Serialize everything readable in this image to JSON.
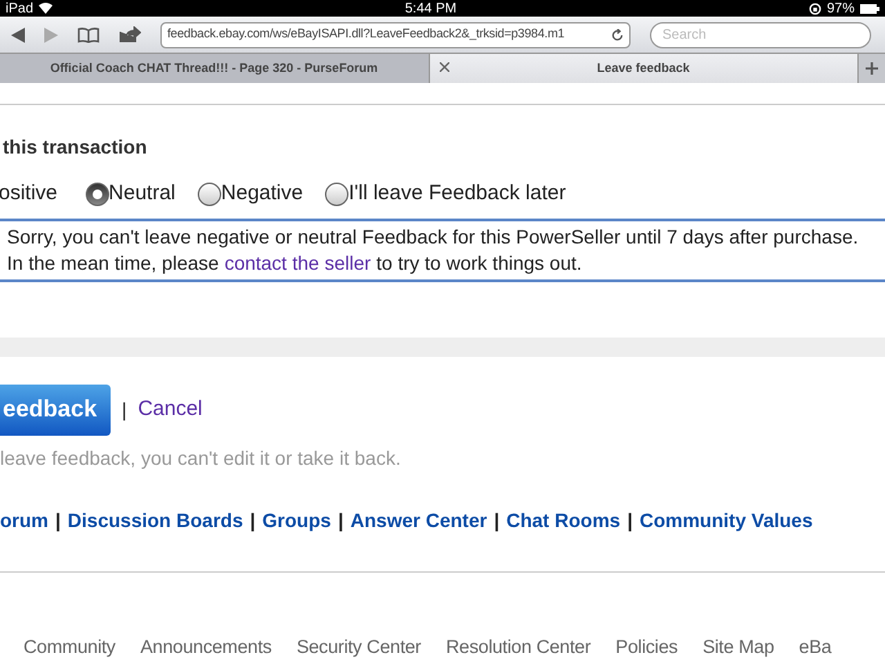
{
  "status_bar": {
    "device": "iPad",
    "time": "5:44 PM",
    "battery": "97%"
  },
  "browser": {
    "url": "feedback.ebay.com/ws/eBayISAPI.dll?LeaveFeedback2&_trksid=p3984.m1",
    "search": {
      "placeholder": "Search"
    },
    "tabs": [
      {
        "label": "Official Coach CHAT Thread!!! - Page 320 - PurseForum",
        "selected": false
      },
      {
        "label": "Leave feedback",
        "selected": true
      }
    ]
  },
  "heading": "this transaction",
  "rating_options": [
    {
      "kind": "cut",
      "label": "ositive"
    },
    {
      "kind": "radio",
      "label": "Neutral",
      "selected": true
    },
    {
      "kind": "radio",
      "label": "Negative",
      "selected": false
    },
    {
      "kind": "radio",
      "label": "I'll leave Feedback later",
      "selected": false
    }
  ],
  "notice": {
    "line1": "Sorry, you can't leave negative or neutral Feedback for this PowerSeller until 7 days after purchase.",
    "line2_before": "In the mean time, please",
    "link": "contact the seller",
    "line2_after": "to try to work things out."
  },
  "submit_button": "eedback",
  "separator": "|",
  "cancel_link": "Cancel",
  "warning": "leave feedback, you can't edit it or take it back.",
  "link_separator": "|",
  "community_links": [
    "orum",
    "Discussion Boards",
    "Groups",
    "Answer Center",
    "Chat Rooms",
    "Community Values"
  ],
  "footer_links": [
    "Community",
    "Announcements",
    "Security Center",
    "Resolution Center",
    "Policies",
    "Site Map",
    "eBa"
  ]
}
